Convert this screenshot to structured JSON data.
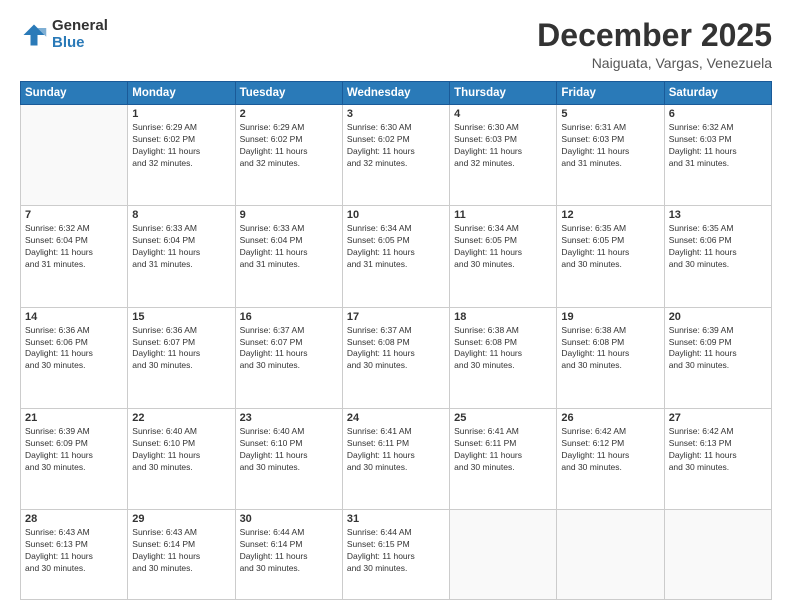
{
  "logo": {
    "general": "General",
    "blue": "Blue"
  },
  "header": {
    "month": "December 2025",
    "location": "Naiguata, Vargas, Venezuela"
  },
  "days_of_week": [
    "Sunday",
    "Monday",
    "Tuesday",
    "Wednesday",
    "Thursday",
    "Friday",
    "Saturday"
  ],
  "weeks": [
    [
      {
        "day": "",
        "info": ""
      },
      {
        "day": "1",
        "info": "Sunrise: 6:29 AM\nSunset: 6:02 PM\nDaylight: 11 hours\nand 32 minutes."
      },
      {
        "day": "2",
        "info": "Sunrise: 6:29 AM\nSunset: 6:02 PM\nDaylight: 11 hours\nand 32 minutes."
      },
      {
        "day": "3",
        "info": "Sunrise: 6:30 AM\nSunset: 6:02 PM\nDaylight: 11 hours\nand 32 minutes."
      },
      {
        "day": "4",
        "info": "Sunrise: 6:30 AM\nSunset: 6:03 PM\nDaylight: 11 hours\nand 32 minutes."
      },
      {
        "day": "5",
        "info": "Sunrise: 6:31 AM\nSunset: 6:03 PM\nDaylight: 11 hours\nand 31 minutes."
      },
      {
        "day": "6",
        "info": "Sunrise: 6:32 AM\nSunset: 6:03 PM\nDaylight: 11 hours\nand 31 minutes."
      }
    ],
    [
      {
        "day": "7",
        "info": "Sunrise: 6:32 AM\nSunset: 6:04 PM\nDaylight: 11 hours\nand 31 minutes."
      },
      {
        "day": "8",
        "info": "Sunrise: 6:33 AM\nSunset: 6:04 PM\nDaylight: 11 hours\nand 31 minutes."
      },
      {
        "day": "9",
        "info": "Sunrise: 6:33 AM\nSunset: 6:04 PM\nDaylight: 11 hours\nand 31 minutes."
      },
      {
        "day": "10",
        "info": "Sunrise: 6:34 AM\nSunset: 6:05 PM\nDaylight: 11 hours\nand 31 minutes."
      },
      {
        "day": "11",
        "info": "Sunrise: 6:34 AM\nSunset: 6:05 PM\nDaylight: 11 hours\nand 30 minutes."
      },
      {
        "day": "12",
        "info": "Sunrise: 6:35 AM\nSunset: 6:05 PM\nDaylight: 11 hours\nand 30 minutes."
      },
      {
        "day": "13",
        "info": "Sunrise: 6:35 AM\nSunset: 6:06 PM\nDaylight: 11 hours\nand 30 minutes."
      }
    ],
    [
      {
        "day": "14",
        "info": "Sunrise: 6:36 AM\nSunset: 6:06 PM\nDaylight: 11 hours\nand 30 minutes."
      },
      {
        "day": "15",
        "info": "Sunrise: 6:36 AM\nSunset: 6:07 PM\nDaylight: 11 hours\nand 30 minutes."
      },
      {
        "day": "16",
        "info": "Sunrise: 6:37 AM\nSunset: 6:07 PM\nDaylight: 11 hours\nand 30 minutes."
      },
      {
        "day": "17",
        "info": "Sunrise: 6:37 AM\nSunset: 6:08 PM\nDaylight: 11 hours\nand 30 minutes."
      },
      {
        "day": "18",
        "info": "Sunrise: 6:38 AM\nSunset: 6:08 PM\nDaylight: 11 hours\nand 30 minutes."
      },
      {
        "day": "19",
        "info": "Sunrise: 6:38 AM\nSunset: 6:08 PM\nDaylight: 11 hours\nand 30 minutes."
      },
      {
        "day": "20",
        "info": "Sunrise: 6:39 AM\nSunset: 6:09 PM\nDaylight: 11 hours\nand 30 minutes."
      }
    ],
    [
      {
        "day": "21",
        "info": "Sunrise: 6:39 AM\nSunset: 6:09 PM\nDaylight: 11 hours\nand 30 minutes."
      },
      {
        "day": "22",
        "info": "Sunrise: 6:40 AM\nSunset: 6:10 PM\nDaylight: 11 hours\nand 30 minutes."
      },
      {
        "day": "23",
        "info": "Sunrise: 6:40 AM\nSunset: 6:10 PM\nDaylight: 11 hours\nand 30 minutes."
      },
      {
        "day": "24",
        "info": "Sunrise: 6:41 AM\nSunset: 6:11 PM\nDaylight: 11 hours\nand 30 minutes."
      },
      {
        "day": "25",
        "info": "Sunrise: 6:41 AM\nSunset: 6:11 PM\nDaylight: 11 hours\nand 30 minutes."
      },
      {
        "day": "26",
        "info": "Sunrise: 6:42 AM\nSunset: 6:12 PM\nDaylight: 11 hours\nand 30 minutes."
      },
      {
        "day": "27",
        "info": "Sunrise: 6:42 AM\nSunset: 6:13 PM\nDaylight: 11 hours\nand 30 minutes."
      }
    ],
    [
      {
        "day": "28",
        "info": "Sunrise: 6:43 AM\nSunset: 6:13 PM\nDaylight: 11 hours\nand 30 minutes."
      },
      {
        "day": "29",
        "info": "Sunrise: 6:43 AM\nSunset: 6:14 PM\nDaylight: 11 hours\nand 30 minutes."
      },
      {
        "day": "30",
        "info": "Sunrise: 6:44 AM\nSunset: 6:14 PM\nDaylight: 11 hours\nand 30 minutes."
      },
      {
        "day": "31",
        "info": "Sunrise: 6:44 AM\nSunset: 6:15 PM\nDaylight: 11 hours\nand 30 minutes."
      },
      {
        "day": "",
        "info": ""
      },
      {
        "day": "",
        "info": ""
      },
      {
        "day": "",
        "info": ""
      }
    ]
  ]
}
